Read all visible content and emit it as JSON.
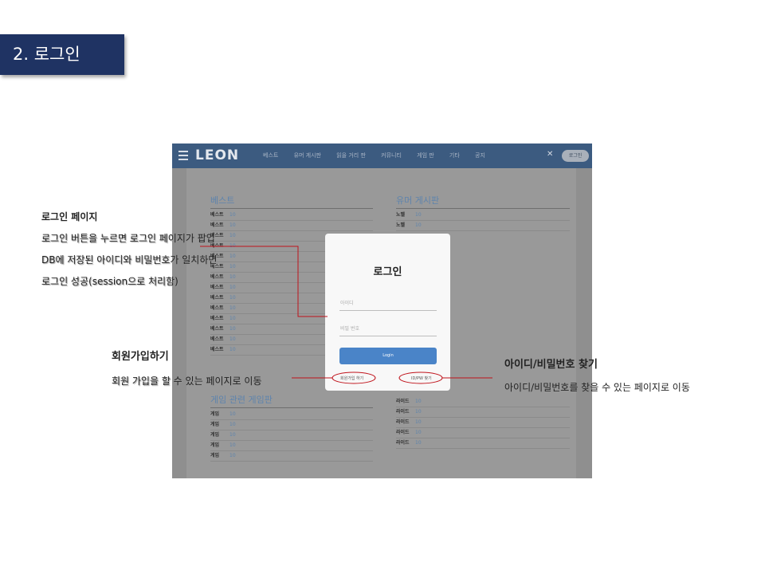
{
  "slide": {
    "title": "2. 로그인"
  },
  "app": {
    "logo": "LEON",
    "menu": [
      "베스트",
      "유머 게시판",
      "읽을 거리 판",
      "커뮤니티",
      "게임 판",
      "기타",
      "공지"
    ],
    "shuffle_icon": "shuffle-icon",
    "login_button": "로그인"
  },
  "columns": [
    {
      "heading": "베스트",
      "rows": [
        {
          "label": "베스트",
          "count": "10"
        },
        {
          "label": "베스트",
          "count": "10"
        },
        {
          "label": "베스트",
          "count": "10"
        },
        {
          "label": "베스트",
          "count": "10"
        },
        {
          "label": "베스트",
          "count": "10"
        },
        {
          "label": "베스트",
          "count": "10"
        },
        {
          "label": "베스트",
          "count": "10"
        },
        {
          "label": "베스트",
          "count": "10"
        },
        {
          "label": "베스트",
          "count": "10"
        },
        {
          "label": "베스트",
          "count": "10"
        },
        {
          "label": "베스트",
          "count": "10"
        },
        {
          "label": "베스트",
          "count": "10"
        },
        {
          "label": "베스트",
          "count": "10"
        },
        {
          "label": "베스트",
          "count": "10"
        }
      ]
    },
    {
      "heading": "유머 게시판",
      "rows": [
        {
          "label": "노벨",
          "count": "10"
        },
        {
          "label": "노벨",
          "count": "10"
        }
      ]
    },
    {
      "heading": "게임 관련 게임판",
      "rows": [
        {
          "label": "게임",
          "count": "10"
        },
        {
          "label": "게임",
          "count": "10"
        },
        {
          "label": "게임",
          "count": "10"
        },
        {
          "label": "게임",
          "count": "10"
        },
        {
          "label": "게임",
          "count": "10"
        }
      ]
    },
    {
      "heading": "",
      "rows": [
        {
          "label": "라이드",
          "count": "10"
        },
        {
          "label": "라이드",
          "count": "10"
        },
        {
          "label": "라이드",
          "count": "10"
        },
        {
          "label": "라이드",
          "count": "10"
        },
        {
          "label": "라이드",
          "count": "10"
        }
      ]
    }
  ],
  "modal": {
    "title": "로그인",
    "id_placeholder": "아이디",
    "pw_placeholder": "비밀 번호",
    "submit": "Login",
    "signup_link": "회원가입 하기",
    "find_link": "ID/PW 찾기"
  },
  "annotations": {
    "login": {
      "title": "로그인 페이지",
      "line1": "로그인 버튼을 누르면 로그인 페이지가 팝업",
      "line2": "DB에 저장된 아이디와 비밀번호가 일치하면",
      "line3": "로그인 성공(session으로 처리함)"
    },
    "signup": {
      "title": "회원가입하기",
      "desc": "회원 가입을 할 수 있는 페이지로 이동"
    },
    "find": {
      "title": "아이디/비밀번호 찾기",
      "desc": "아이디/비밀번호를 찾을 수 있는 페이지로 이동"
    }
  },
  "colors": {
    "title_bg": "#1f3363",
    "nav_bg": "#3c5b80",
    "link_accent": "#5e84ad",
    "submit_bg": "#4a84c8",
    "callout_line": "#c0141c"
  }
}
